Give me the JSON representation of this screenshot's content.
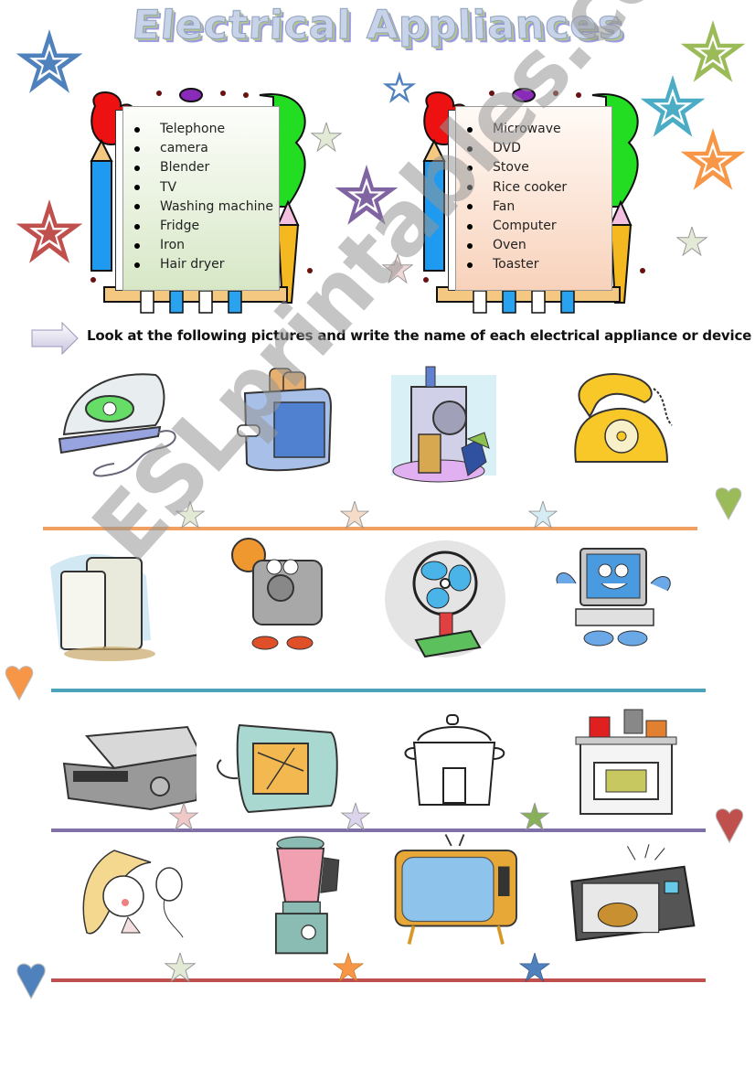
{
  "title": "Electrical Appliances",
  "word_boxes": [
    {
      "color_theme": "green",
      "words": [
        "Telephone",
        "camera",
        "Blender",
        "TV",
        "Washing machine",
        "Fridge",
        "Iron",
        "Hair dryer"
      ]
    },
    {
      "color_theme": "peach",
      "words": [
        "Microwave",
        "DVD",
        "Stove",
        "Rice cooker",
        "Fan",
        "Computer",
        "Oven",
        "Toaster"
      ]
    }
  ],
  "instruction": "Look at the following pictures and write the name of each electrical appliance or device",
  "picture_rows": [
    {
      "line_color": "#f0a060",
      "pictures": [
        "iron",
        "toaster",
        "washing-machine",
        "telephone"
      ]
    },
    {
      "line_color": "#4aa3b8",
      "pictures": [
        "fridge",
        "camera",
        "fan",
        "computer"
      ]
    },
    {
      "line_color": "#8070a8",
      "pictures": [
        "dvd-player",
        "oven",
        "rice-cooker",
        "stove"
      ]
    },
    {
      "line_color": "#c0504d",
      "pictures": [
        "hair-dryer",
        "blender",
        "tv",
        "microwave"
      ]
    }
  ],
  "decorations": {
    "star_colors": [
      "#4f81bd",
      "#c0504d",
      "#9bbb59",
      "#4bacc6",
      "#f79646",
      "#8064a2"
    ],
    "heart_colors": [
      "#9bbb59",
      "#f79646",
      "#c0504d",
      "#4f81bd"
    ]
  },
  "watermark": "ESLprintables.com"
}
